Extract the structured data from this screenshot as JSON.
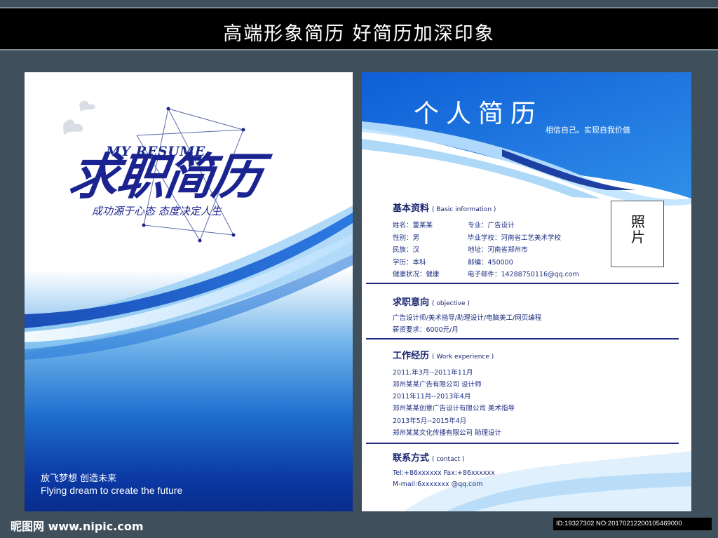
{
  "banner": {
    "title": "高端形象简历  好简历加深印象"
  },
  "cover": {
    "brand_en": "MY RESUME",
    "brand_cn": "求职简历",
    "slogan": "成功源于心态 态度决定人生",
    "footer_cn": "放飞梦想  创造未来",
    "footer_en": "Flying dream to create the future"
  },
  "resume": {
    "title": "个人简历",
    "subtitle": "相信自己。实现自我价值",
    "photo_label": "照片",
    "basic": {
      "title": "基本资料",
      "title_en": "( Basic information )",
      "left": [
        "姓名：董某某",
        "性别：男",
        "民族：汉",
        "学历：本科",
        "健康状况：健康"
      ],
      "right": [
        "专业：广告设计",
        "毕业学校：河南省工艺美术学校",
        "地址：河南省郑州市",
        "邮编：450000",
        "电子邮件：14288750116@qq.com"
      ]
    },
    "objective": {
      "title": "求职意向",
      "title_en": "( objective )",
      "lines": [
        "广告设计师/美术指导/助理设计/电脑美工/网页编程",
        "薪资要求：6000元/月"
      ]
    },
    "work": {
      "title": "工作经历",
      "title_en": "( Work experience )",
      "lines": [
        "2011.年3月--2011年11月",
        "郑州某某广告有限公司  设计师",
        "2011年11月--2013年4月",
        "郑州某某创意广告设计有限公司  美术指导",
        "2013年5月--2015年4月",
        "郑州某某文化传播有限公司 助理设计"
      ]
    },
    "contact": {
      "title": "联系方式",
      "title_en": "( contact )",
      "lines": [
        "Tel:+86xxxxxx Fax:+86xxxxxx",
        "M-mail:6xxxxxxx @qq.com"
      ]
    }
  },
  "watermark": {
    "site": "昵图网 www.nipic.com",
    "id": "ID:19327302 NO:20170212200105469000"
  },
  "colors": {
    "navy": "#1a2390",
    "blue": "#1e6fd0",
    "background": "#3f4f5c"
  }
}
